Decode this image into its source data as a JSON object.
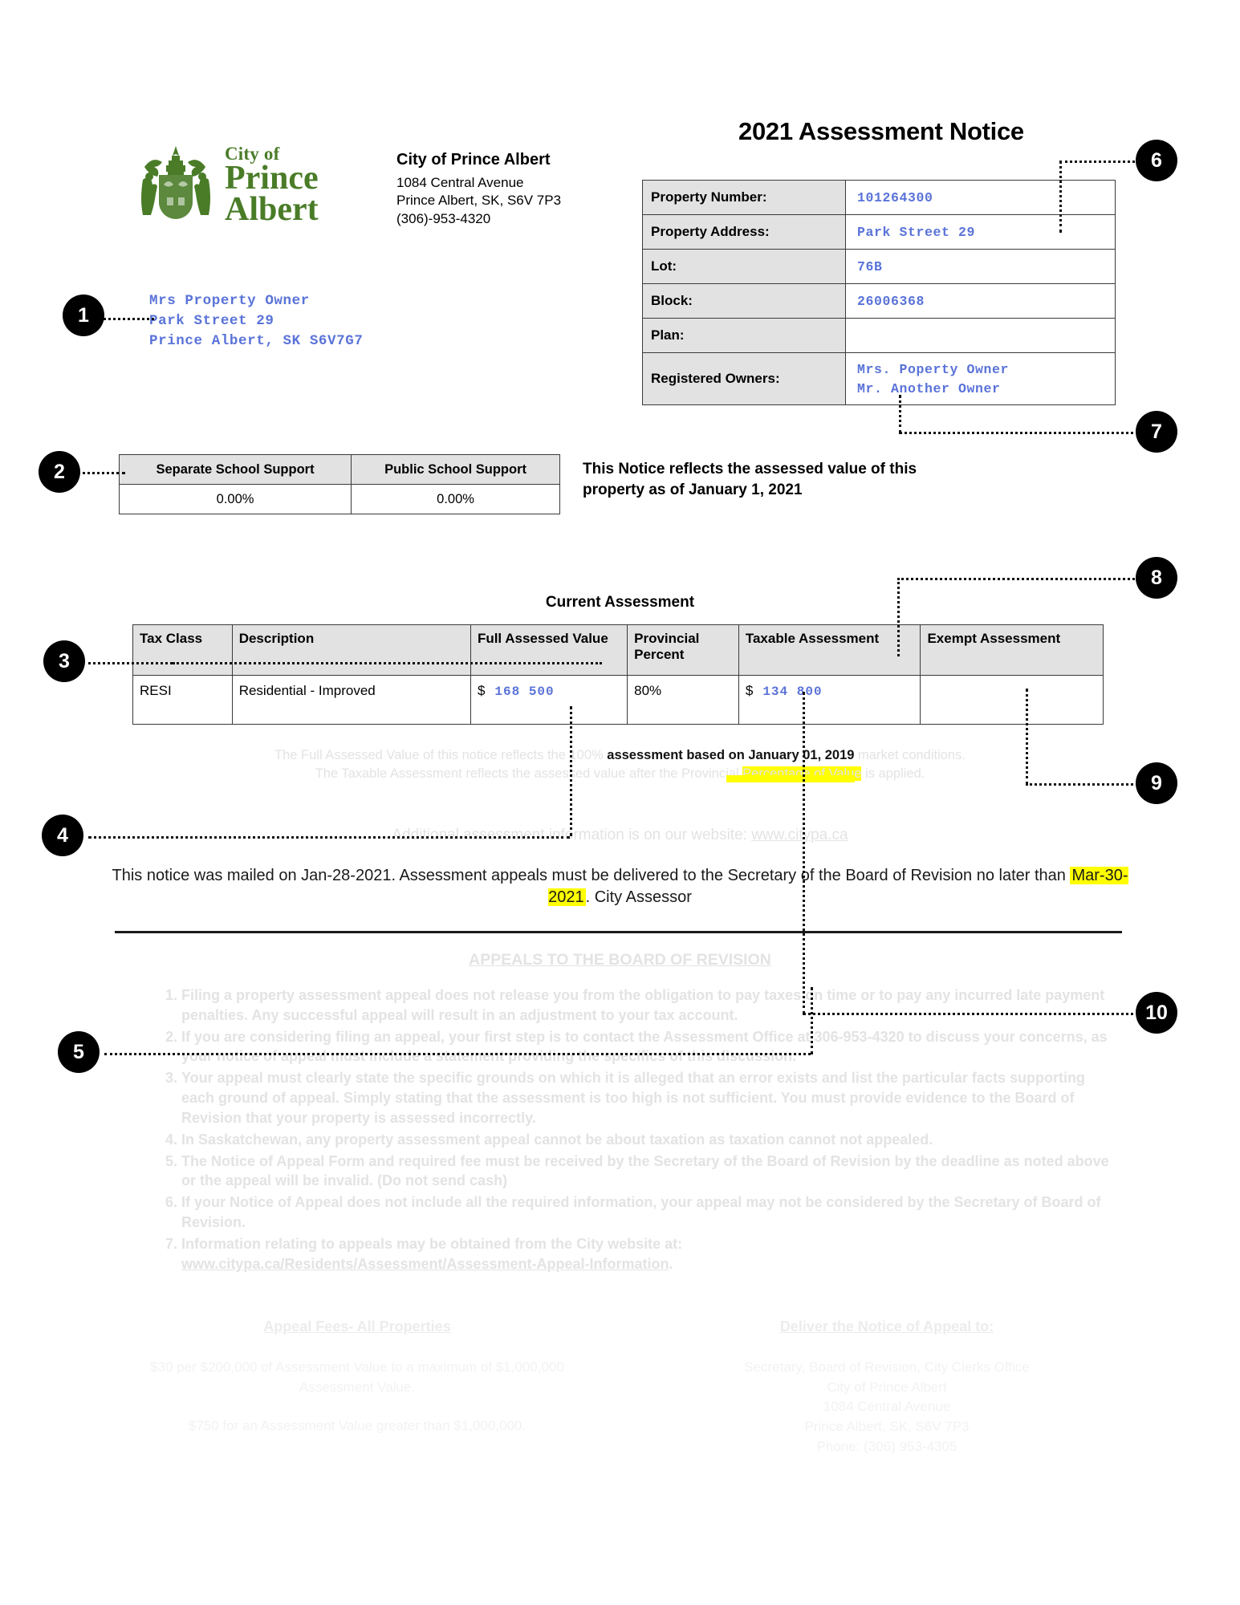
{
  "document": {
    "notice_title": "2021 Assessment Notice"
  },
  "letterhead": {
    "logo_line1": "City of",
    "logo_line2": "Prince",
    "logo_line3": "Albert",
    "crest_icon": "city-crest-icon",
    "city_name": "City of Prince Albert",
    "address_line1": "1084 Central Avenue",
    "address_line2": "Prince Albert, SK, S6V 7P3",
    "phone": "(306)-953-4320"
  },
  "mailing_address": {
    "line1": "Mrs Property Owner",
    "line2": "Park Street 29",
    "line3": "Prince Albert, SK S6V7G7"
  },
  "property": {
    "rows": [
      {
        "label": "Property Number:",
        "value": "101264300"
      },
      {
        "label": "Property Address:",
        "value": "Park Street 29"
      },
      {
        "label": "Lot:",
        "value": "76B"
      },
      {
        "label": "Block:",
        "value": "26006368"
      },
      {
        "label": "Plan:",
        "value": ""
      }
    ],
    "owners_label": "Registered Owners:",
    "owners_line1": "Mrs. Poperty Owner",
    "owners_line2": "Mr. Another Owner"
  },
  "school_support": {
    "header_separate": "Separate School Support",
    "header_public": "Public School Support",
    "value_separate": "0.00%",
    "value_public": "0.00%"
  },
  "notice_reflects": {
    "line1": "This Notice reflects the assessed value of this",
    "line2": "property as of January 1, 2021"
  },
  "current_assessment": {
    "title": "Current Assessment",
    "headers": {
      "tax_class": "Tax Class",
      "description": "Description",
      "full_assessed_value": "Full Assessed Value",
      "provincial_percent": "Provincial Percent",
      "taxable_assessment": "Taxable Assessment",
      "exempt_assessment": "Exempt Assessment"
    },
    "row": {
      "tax_class": "RESI",
      "description": "Residential - Improved",
      "full_assessed_currency": "$",
      "full_assessed_value": "168 500",
      "provincial_percent": "80%",
      "taxable_currency": "$",
      "taxable_assessment": "134 800",
      "exempt_assessment": ""
    }
  },
  "fine_print": {
    "line1_a": "The Full Assessed Value of this notice reflects the 100% ",
    "line1_b": "assessment based on ",
    "line1_highlight": "January 01, 2019",
    "line1_c": " market conditions.",
    "line2_a": "The Taxable Assessment reflects the assessed value after the Provincial ",
    "line2_highlight": "Percentage of Value",
    "line2_b": " is applied."
  },
  "website_line": {
    "text": "Additional assessment information is on our website: ",
    "url": "www.citypa.ca"
  },
  "mailed_notice": {
    "part1": "This notice was mailed on Jan-28-2021. Assessment appeals must be delivered to the Secretary of the Board of Revision no later than ",
    "deadline": "Mar-30-2021",
    "part2": ". City Assessor"
  },
  "appeals": {
    "title": "APPEALS TO THE BOARD OF REVISION",
    "items": [
      "Filing a property assessment appeal does not release you from the obligation to pay taxes on time or to pay any incurred late payment penalties. Any successful appeal will result in an adjustment to your tax account.",
      "If you are considering filing an appeal, your first step is to contact the Assessment Office at 306-953-4320 to discuss your concerns, as your notice of appeal must include a statement providing the specifics of this discussion.",
      "Your appeal must clearly state the specific grounds on which it is alleged that an error exists and list the particular facts supporting each ground of appeal. Simply stating that the assessment is too high is not sufficient. You must provide evidence to the Board of Revision that your property is assessed incorrectly.",
      "In Saskatchewan, any property assessment appeal cannot be about taxation as taxation cannot not appealed.",
      "The Notice of Appeal Form and required fee must be received by the Secretary of the Board of Revision by the deadline as noted above or the appeal will be invalid. (Do not send cash)",
      "If your Notice of Appeal does not include all the required information, your appeal may not be considered by the Secretary of Board of Revision."
    ],
    "item7_lead": "Information relating to appeals may be obtained from the City website at:",
    "item7_url": "www.citypa.ca/Residents/Assessment/Assessment-Appeal-Information",
    "item7_period": "."
  },
  "fees": {
    "heading": "Appeal Fees- All Properties",
    "line1": "$30 per $200,000 of Assessment Value to a maximum of $1,000,000 Assessment Value.",
    "line2": "$750 for an Assessment Value greater than $1,000,000."
  },
  "deliver": {
    "heading": "Deliver the Notice of Appeal to:",
    "line1": "Secretary, Board of Revision, City Clerks Office",
    "line2": "City of Prince Albert",
    "line3": "1084 Central Avenue",
    "line4": "Prince Albert, SK, S6V 7P3",
    "line5": "Phone: (306) 953-4305"
  },
  "markers": {
    "m1": "1",
    "m2": "2",
    "m3": "3",
    "m4": "4",
    "m5": "5",
    "m6": "6",
    "m7": "7",
    "m8": "8",
    "m9": "9",
    "m10": "10"
  },
  "colors": {
    "value_blue": "#5a73d8",
    "logo_green": "#4a7c28",
    "highlight_yellow": "#ffff00",
    "table_header_grey": "#e2e2e2"
  }
}
